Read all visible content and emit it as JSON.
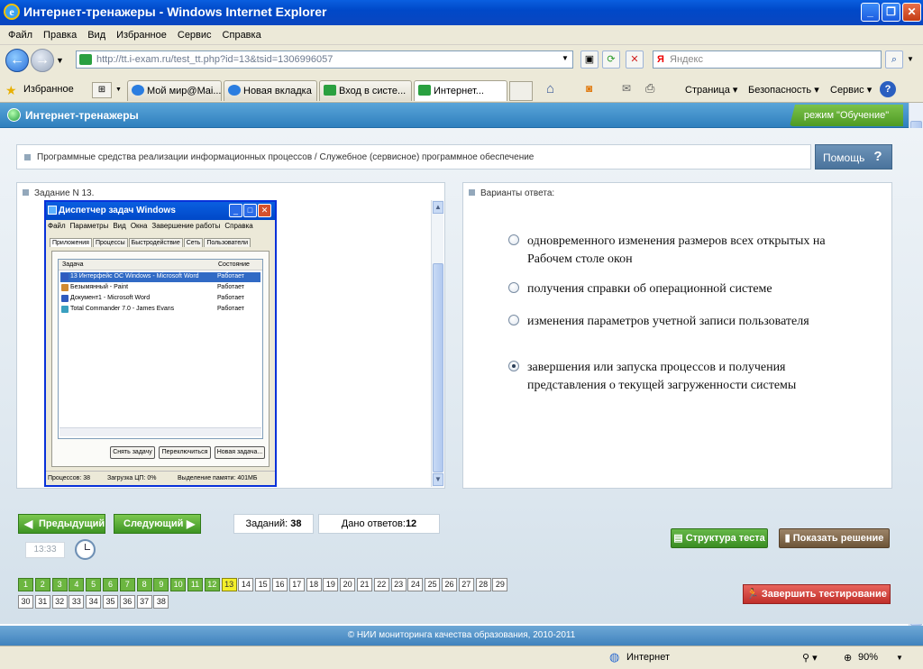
{
  "window": {
    "title": "Интернет-тренажеры - Windows Internet Explorer"
  },
  "menu": [
    "Файл",
    "Правка",
    "Вид",
    "Избранное",
    "Сервис",
    "Справка"
  ],
  "address": {
    "url": "http://tt.i-exam.ru/test_tt.php?id=13&tsid=1306996057",
    "search_placeholder": "Яндекс",
    "search_brand": "Я"
  },
  "favorites": {
    "label": "Избранное"
  },
  "tabs": [
    "Мой мир@Mai...",
    "Новая вкладка",
    "Вход в систе...",
    "Интернет..."
  ],
  "toolbar": {
    "page": "Страница",
    "security": "Безопасность",
    "service": "Сервис"
  },
  "app": {
    "title": "Интернет-тренажеры",
    "mode": "режим \"Обучение\"",
    "breadcrumb": "Программные средства реализации информационных процессов / Служебное (сервисное) программное обеспечение",
    "help": "Помощь",
    "help_icon": "?"
  },
  "question": {
    "header": "Задание N 13."
  },
  "taskmgr": {
    "title": "Диспетчер задач Windows",
    "menu": [
      "Файл",
      "Параметры",
      "Вид",
      "Окна",
      "Завершение работы",
      "Справка"
    ],
    "tabs": [
      "Приложения",
      "Процессы",
      "Быстродействие",
      "Сеть",
      "Пользователи"
    ],
    "col_task": "Задача",
    "col_state": "Состояние",
    "rows": [
      {
        "task": "13 Интерфейс ОС Windows - Microsoft Word",
        "state": "Работает"
      },
      {
        "task": "Безымянный - Paint",
        "state": "Работает"
      },
      {
        "task": "Документ1 - Microsoft Word",
        "state": "Работает"
      },
      {
        "task": "Total Commander 7.0 - James Evans",
        "state": "Работает"
      }
    ],
    "buttons": [
      "Снять задачу",
      "Переключиться",
      "Новая задача..."
    ],
    "status": [
      "Процессов: 38",
      "Загрузка ЦП: 0%",
      "Выделение памяти: 401МБ"
    ]
  },
  "answers": {
    "header": "Варианты ответа:",
    "options": [
      {
        "text": "одновременного изменения размеров всех открытых на Рабочем столе окон",
        "selected": false
      },
      {
        "text": "получения справки об операционной системе",
        "selected": false
      },
      {
        "text": "изменения параметров учетной записи пользователя",
        "selected": false
      },
      {
        "text": "завершения или запуска процессов и получения представления о текущей загруженности системы",
        "selected": true
      }
    ]
  },
  "nav": {
    "prev": "Предыдущий",
    "next": "Следующий",
    "tasks_label": "Заданий:",
    "tasks_count": "38",
    "answered_label": "Дано ответов:",
    "answered_count": "12",
    "time": "13:33"
  },
  "actions": {
    "structure": "Структура теста",
    "solution": "Показать решение",
    "finish": "Завершить тестирование"
  },
  "questions": {
    "total": 38,
    "answered": 12,
    "current": 13
  },
  "footer": "© НИИ мониторинга качества образования, 2010-2011",
  "status": {
    "zone": "Интернет",
    "zoom": "90%"
  }
}
